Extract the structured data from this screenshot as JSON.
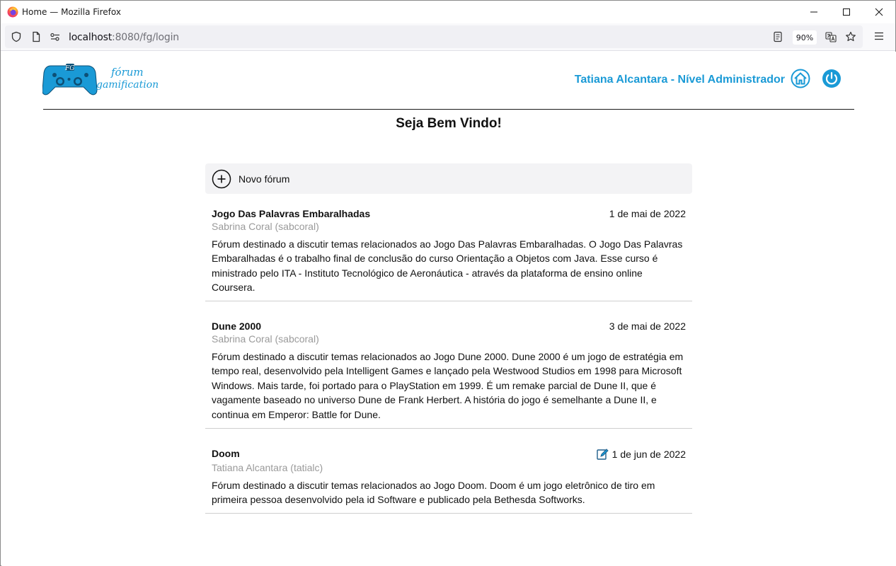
{
  "browser": {
    "window_title": "Home — Mozilla Firefox",
    "url_host": "localhost",
    "url_path": ":8080/fg/login",
    "zoom": "90%"
  },
  "header": {
    "logo_line1": "fórum",
    "logo_line2": "gamification",
    "logo_badge": "FG",
    "user_label": "Tatiana Alcantara - Nível Administrador"
  },
  "welcome": "Seja Bem Vindo!",
  "new_forum_label": "Novo fórum",
  "forums": [
    {
      "title": "Jogo Das Palavras Embaralhadas",
      "date": "1 de mai de 2022",
      "author": "Sabrina Coral (sabcoral)",
      "description": "Fórum destinado a discutir temas relacionados ao Jogo Das Palavras Embaralhadas. O Jogo Das Palavras Embaralhadas é o trabalho final de conclusão do curso Orientação a Objetos com Java. Esse curso é ministrado pelo ITA - Instituto Tecnológico de Aeronáutica - através da plataforma de ensino online Coursera."
    },
    {
      "title": "Dune 2000",
      "date": "3 de mai de 2022",
      "author": "Sabrina Coral (sabcoral)",
      "description": "Fórum destinado a discutir temas relacionados ao Jogo Dune 2000. Dune 2000 é um jogo de estratégia em tempo real, desenvolvido pela Intelligent Games e lançado pela Westwood Studios em 1998 para Microsoft Windows. Mais tarde, foi portado para o PlayStation em 1999. É um remake parcial de Dune II, que é vagamente baseado no universo Dune de Frank Herbert. A história do jogo é semelhante a Dune II, e continua em Emperor: Battle for Dune."
    },
    {
      "title": "Doom",
      "date": "1 de jun de 2022",
      "author": "Tatiana Alcantara (tatialc)",
      "description": "Fórum destinado a discutir temas relacionados ao Jogo Doom. Doom é um jogo eletrônico de tiro em primeira pessoa desenvolvido pela id Software e publicado pela Bethesda Softworks."
    }
  ],
  "colors": {
    "accent": "#1a9ad6",
    "author_gray": "#9a9a9a"
  }
}
